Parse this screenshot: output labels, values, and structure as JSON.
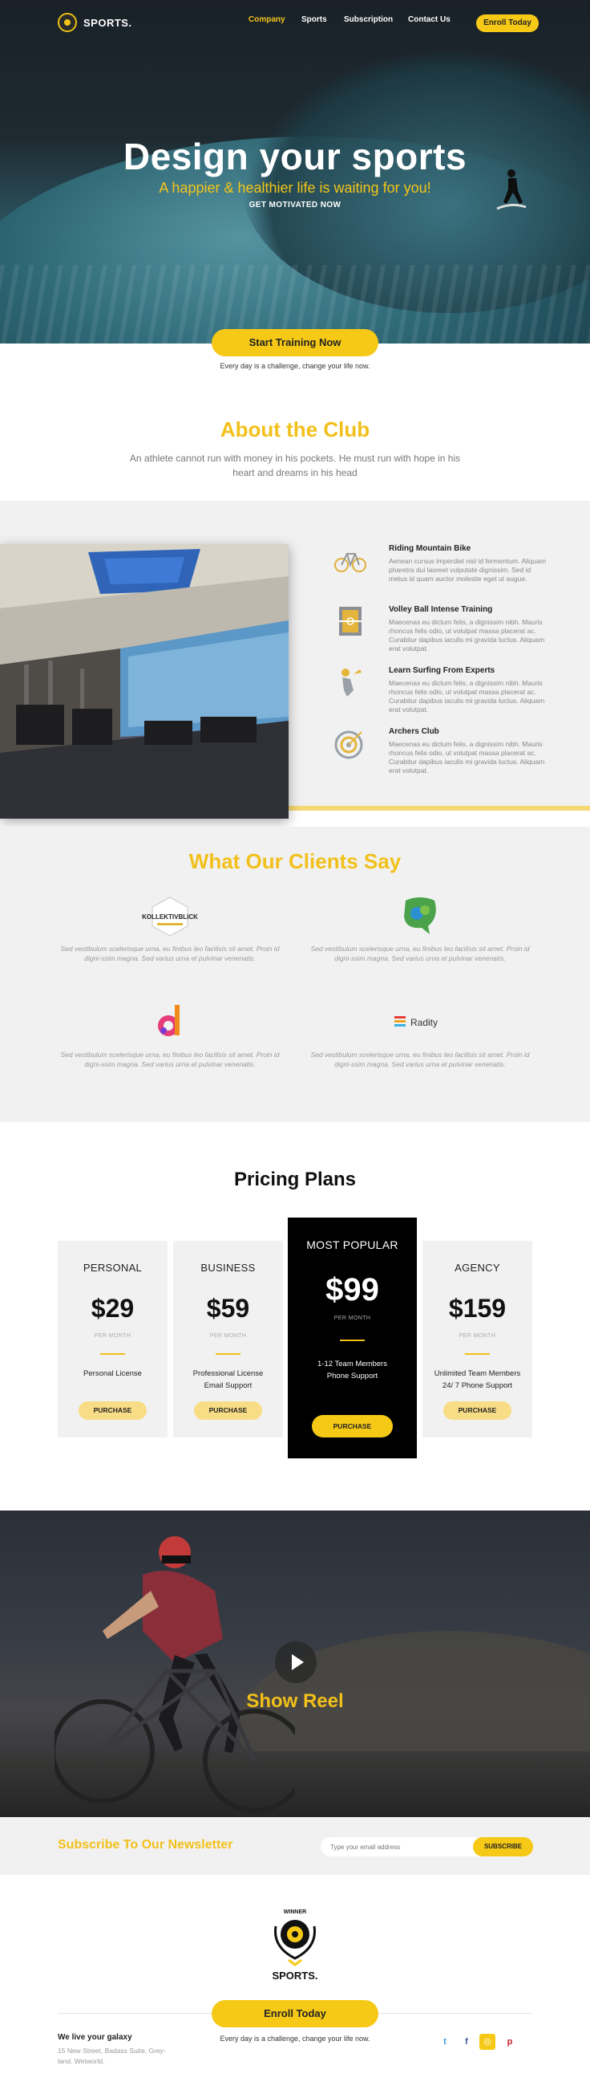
{
  "header": {
    "logo_text": "SPORTS.",
    "nav": [
      "Company",
      "Sports",
      "Subscription",
      "Contact Us"
    ],
    "enroll_label": "Enroll Today"
  },
  "hero": {
    "title": "Design your sports",
    "subtitle": "A happier & healthier life is waiting for you!",
    "motivation": "GET MOTIVATED NOW"
  },
  "cta": {
    "start_label": "Start Training Now",
    "note": "Every day is a challenge, change your life now."
  },
  "about": {
    "title": "About the Club",
    "text": "An athlete cannot run with money in his pockets. He must run with hope in his heart and dreams in his head"
  },
  "features": [
    {
      "title": "Riding Mountain Bike",
      "text": "Aenean cursus imperdiet nisl id fermentum. Aliquam pharetra dui laoreet vulputate dignissim. Sed id metus id quam auctor molestie eget ut augue.",
      "icon": "bicycle-icon"
    },
    {
      "title": "Volley Ball Intense Training",
      "text": "Maecenas eu dictum felis, a dignissim nibh. Mauris rhoncus felis odio, ut volutpat massa placerat ac. Curabitur dapibus iaculis mi gravida luctus. Aliquam erat volutpat.",
      "icon": "volleyball-court-icon"
    },
    {
      "title": "Learn Surfing From Experts",
      "text": "Maecenas eu dictum felis, a dignissim nibh. Mauris rhoncus felis odio, ut volutpat massa placerat ac. Curabitur dapibus iaculis mi gravida luctus. Aliquam erat volutpat.",
      "icon": "surfing-icon"
    },
    {
      "title": "Archers Club",
      "text": "Maecenas eu dictum felis, a dignissim nibh. Mauris rhoncus felis odio, ut volutpat massa placerat ac. Curabitur dapibus iaculis mi gravida luctus. Aliquam erat volutpat.",
      "icon": "archery-target-icon"
    }
  ],
  "clients": {
    "title": "What Our Clients Say",
    "items": [
      {
        "logo": "KOLLEKTIVBLICK",
        "text": "Sed vestibulum scelerisque urna, eu finibus leo facilisis sit amet. Proin id digni-ssim magna. Sed varius urna et pulvinar venenatis."
      },
      {
        "logo": "speech-bubble-logo",
        "text": "Sed vestibulum scelerisque urna, eu finibus leo facilisis sit amet. Proin id digni-ssim magna. Sed varius urna et pulvinar venenatis."
      },
      {
        "logo": "d-logo",
        "text": "Sed vestibulum scelerisque urna, eu finibus leo facilisis sit amet. Proin id digni-ssim magna. Sed varius urna et pulvinar venenatis."
      },
      {
        "logo": "Radity",
        "text": "Sed vestibulum scelerisque urna, eu finibus leo facilisis sit amet. Proin id digni-ssim magna. Sed varius urna et pulvinar venenatis."
      }
    ]
  },
  "pricing": {
    "title": "Pricing Plans",
    "plans": [
      {
        "name": "PERSONAL",
        "price": "$29",
        "period": "PER MONTH",
        "features": "Personal License",
        "button": "PURCHASE"
      },
      {
        "name": "BUSINESS",
        "price": "$59",
        "period": "PER MONTH",
        "features": "Professional License\nEmail Support",
        "button": "PURCHASE"
      },
      {
        "name": "MOST POPULAR",
        "price": "$99",
        "period": "PER MONTH",
        "features": "1-12 Team Members\nPhone Support",
        "button": "PURCHASE"
      },
      {
        "name": "AGENCY",
        "price": "$159",
        "period": "PER MONTH",
        "features": "Unlimited Team Members\n24/ 7 Phone Support",
        "button": "PURCHASE"
      }
    ]
  },
  "reel": {
    "title": "Show Reel"
  },
  "newsletter": {
    "title": "Subscribe To Our Newsletter",
    "placeholder": "Type your email address",
    "button": "SUBSCRIBE"
  },
  "footer": {
    "badge_text": "SPORTS.",
    "badge_ribbon": "WINNER",
    "enroll_label": "Enroll Today",
    "note": "Every day is a challenge, change your life now.",
    "address_title": "We live your galaxy",
    "address": "15 New Street, Badass Suite, Grey-land. Wetworld.",
    "social": [
      {
        "icon": "twitter-icon",
        "glyph": "t"
      },
      {
        "icon": "facebook-icon",
        "glyph": "f"
      },
      {
        "icon": "instagram-icon",
        "glyph": "◎"
      },
      {
        "icon": "pinterest-icon",
        "glyph": "p"
      }
    ]
  },
  "colors": {
    "accent": "#f6c917",
    "dark": "#000000",
    "light_bg": "#f1f1f1"
  }
}
